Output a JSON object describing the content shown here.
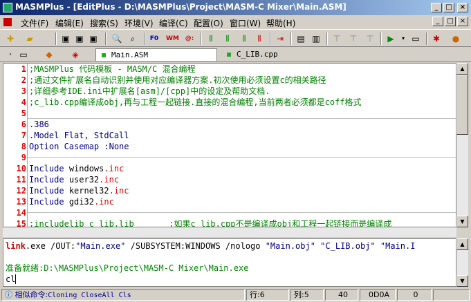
{
  "window": {
    "title": "MASMPlus - [EditPlus - D:\\MASMPlus\\Project\\MASM-C Mixer\\Main.ASM]",
    "controls": {
      "minimize": "_",
      "maximize": "□",
      "close": "×"
    }
  },
  "menu": [
    "文件(F)",
    "编辑(E)",
    "搜索(S)",
    "环境(V)",
    "编译(C)",
    "配置(O)",
    "窗口(W)",
    "帮助(H)"
  ],
  "toolbar": {
    "f0": "F0",
    "wm": "WM",
    "at": "@:"
  },
  "tabs": [
    {
      "label": "Main.ASM",
      "active": true
    },
    {
      "label": "C_LIB.cpp",
      "active": false
    }
  ],
  "editor": {
    "lines": [
      {
        "n": "1",
        "text": ";MASMPlus 代码模板 - MASM/C 混合编程"
      },
      {
        "n": "2",
        "text": ";通过文件扩展名自动识别并使用对应编译器方案.初次使用必须设置c的相关路径"
      },
      {
        "n": "3",
        "text": ";详细参考IDE.ini中扩展名[asm]/[cpp]中的设定及帮助文档."
      },
      {
        "n": "4",
        "text": ";c_lib.cpp编译成obj,再与工程一起链接.直接的混合编程,当前两者必须都是coff格式"
      },
      {
        "n": "5",
        "text": ""
      },
      {
        "n": "6",
        "text": ".386"
      },
      {
        "n": "7",
        "text": ".Model Flat, StdCall"
      },
      {
        "n": "8",
        "text": "Option Casemap :None"
      },
      {
        "n": "9",
        "text": ""
      },
      {
        "n": "10",
        "kw": "Include",
        "file": "windows",
        "ext": ".inc"
      },
      {
        "n": "11",
        "kw": "Include",
        "file": "user32",
        "ext": ".inc"
      },
      {
        "n": "12",
        "kw": "Include",
        "file": "kernel32",
        "ext": ".inc"
      },
      {
        "n": "13",
        "kw": "Include",
        "file": "gdi32",
        "ext": ".inc"
      },
      {
        "n": "14",
        "text": ""
      },
      {
        "n": "15",
        "text": ";includelib c_lib.lib       ;如果c_lib.cpp不是编译成obj和工程一起链接而是编译成"
      }
    ]
  },
  "output": {
    "link_cmd": "link",
    "link_rest": ".exe /OUT:",
    "out_file": "\"Main.exe\"",
    "subsystem": " /SUBSYSTEM:WINDOWS /nologo ",
    "obj1": "\"Main.obj\"",
    "obj2": " \"C_LIB.obj\"",
    "obj3": " \"Main.I",
    "ready": "准备就绪:D:\\MASMPlus\\Project\\MASM-C Mixer\\Main.exe",
    "input": "cl"
  },
  "status": {
    "related_cmd": "相似命令:",
    "cmds": "Cloning CloseAll Cls",
    "row": "行:6",
    "col": "列:5",
    "num": "40",
    "code": "0D0A",
    "zero": "0"
  },
  "colors": {
    "comment": "#008000",
    "keyword": "#00008b",
    "line_number": "#e00000",
    "title_start": "#0a246a",
    "title_end": "#a6caf0"
  }
}
